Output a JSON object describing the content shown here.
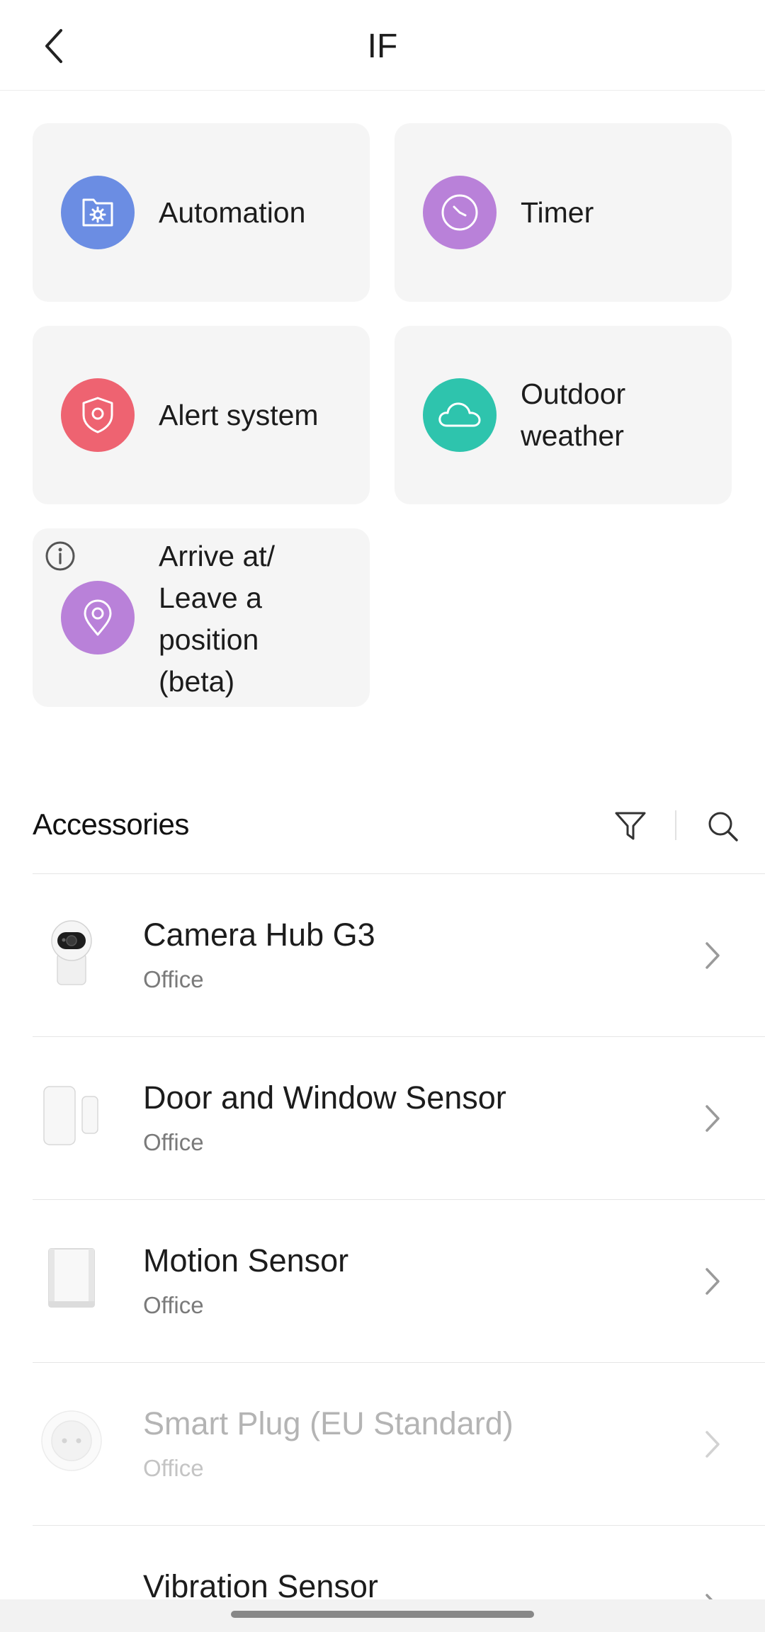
{
  "header": {
    "title": "IF"
  },
  "conditions": [
    {
      "label": "Automation",
      "icon": "automation-icon",
      "color": "#6b8de3"
    },
    {
      "label": "Timer",
      "icon": "clock-icon",
      "color": "#b981d9"
    },
    {
      "label": "Alert system",
      "icon": "shield-icon",
      "color": "#ee6371"
    },
    {
      "label_line1": "Outdoor",
      "label_line2": "weather",
      "icon": "cloud-icon",
      "color": "#2ec4ad"
    },
    {
      "label_line1": "Arrive at/",
      "label_line2": "Leave a",
      "label_line3": "position",
      "label_line4": "(beta)",
      "icon": "location-pin-icon",
      "color": "#b981d9"
    }
  ],
  "accessories": {
    "title": "Accessories",
    "items": [
      {
        "name": "Camera Hub G3",
        "room": "Office",
        "enabled": true
      },
      {
        "name": "Door and Window Sensor",
        "room": "Office",
        "enabled": true
      },
      {
        "name": "Motion Sensor",
        "room": "Office",
        "enabled": true
      },
      {
        "name": "Smart Plug (EU Standard)",
        "room": "Office",
        "enabled": false
      },
      {
        "name": "Vibration Sensor",
        "room": "",
        "enabled": true
      }
    ]
  }
}
